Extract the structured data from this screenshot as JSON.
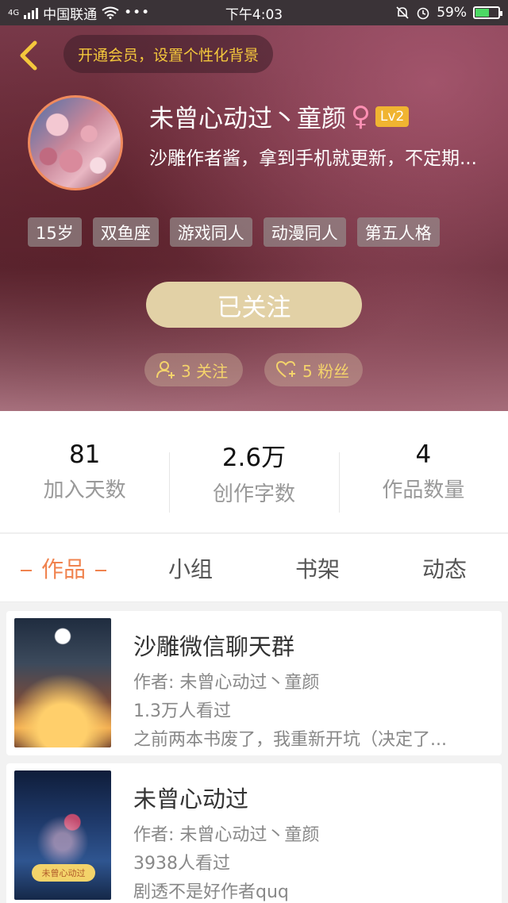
{
  "status_bar": {
    "network": "4G",
    "carrier": "中国联通",
    "time": "下午4:03",
    "battery": "59%",
    "battery_level": 0.59
  },
  "header": {
    "vip_banner": "开通会员，设置个性化背景",
    "username": "未曾心动过丶童颜",
    "gender_symbol": "♀",
    "level": "Lv2",
    "bio": "沙雕作者酱，拿到手机就更新，不定期...",
    "tags": [
      "15岁",
      "双鱼座",
      "游戏同人",
      "动漫同人",
      "第五人格"
    ],
    "follow_button": "已关注",
    "following": "3 关注",
    "fans": "5 粉丝"
  },
  "stats": [
    {
      "value": "81",
      "label": "加入天数"
    },
    {
      "value": "2.6万",
      "label": "创作字数"
    },
    {
      "value": "4",
      "label": "作品数量"
    }
  ],
  "tabs": [
    {
      "label": "作品",
      "active": true
    },
    {
      "label": "小组",
      "active": false
    },
    {
      "label": "书架",
      "active": false
    },
    {
      "label": "动态",
      "active": false
    }
  ],
  "works": [
    {
      "title": "沙雕微信聊天群",
      "author": "作者: 未曾心动过丶童颜",
      "views": "1.3万人看过",
      "desc": "之前两本书废了，我重新开坑（决定了..."
    },
    {
      "title": "未曾心动过",
      "author": "作者: 未曾心动过丶童颜",
      "views": "3938人看过",
      "desc": "剧透不是好作者quq",
      "cover_text": "未曾心动过"
    }
  ],
  "colors": {
    "accent": "#f0834f",
    "vip": "#f4c73c",
    "follow_button": "#e2d1a6",
    "level_badge": "#f0b431"
  }
}
